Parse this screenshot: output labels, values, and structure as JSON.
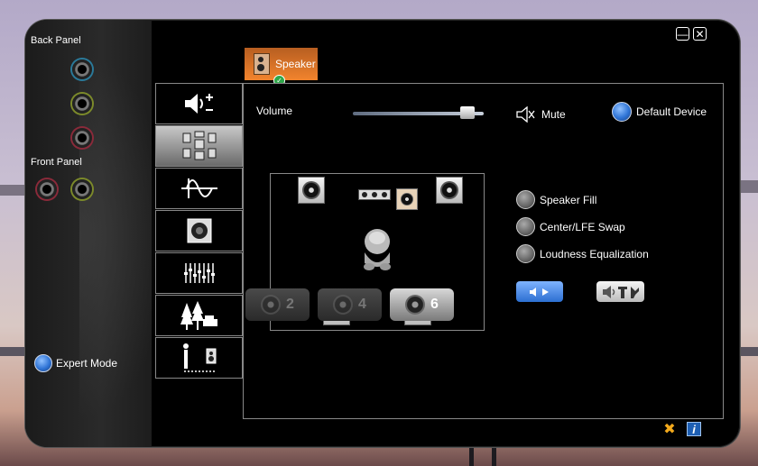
{
  "left_panel": {
    "back_panel_label": "Back Panel",
    "front_panel_label": "Front Panel",
    "expert_mode_label": "Expert Mode"
  },
  "window_controls": {
    "minimize": "—",
    "close": "✕"
  },
  "speaker_tab": {
    "label": "Speaker"
  },
  "side_tabs": [
    {
      "name": "volume-settings",
      "icon": "speaker-volume-icon"
    },
    {
      "name": "speaker-config",
      "icon": "multi-speaker-icon"
    },
    {
      "name": "sound-effects",
      "icon": "waveform-icon"
    },
    {
      "name": "room-correction",
      "icon": "subwoofer-icon"
    },
    {
      "name": "equalizer",
      "icon": "equalizer-icon"
    },
    {
      "name": "environment",
      "icon": "environment-trees-icon"
    },
    {
      "name": "speaker-distance",
      "icon": "person-distance-icon"
    }
  ],
  "main": {
    "volume_label": "Volume",
    "volume_level": 0.92,
    "mute_label": "Mute",
    "default_device_label": "Default Device",
    "options": {
      "speaker_fill": "Speaker Fill",
      "center_lfe_swap": "Center/LFE Swap",
      "loudness_equalization": "Loudness Equalization"
    },
    "config_buttons": [
      {
        "label": "2",
        "active": false
      },
      {
        "label": "4",
        "active": false
      },
      {
        "label": "6",
        "active": true
      }
    ]
  },
  "colors": {
    "tab_orange": "#f2842d",
    "accent_blue": "#2f74d6"
  }
}
